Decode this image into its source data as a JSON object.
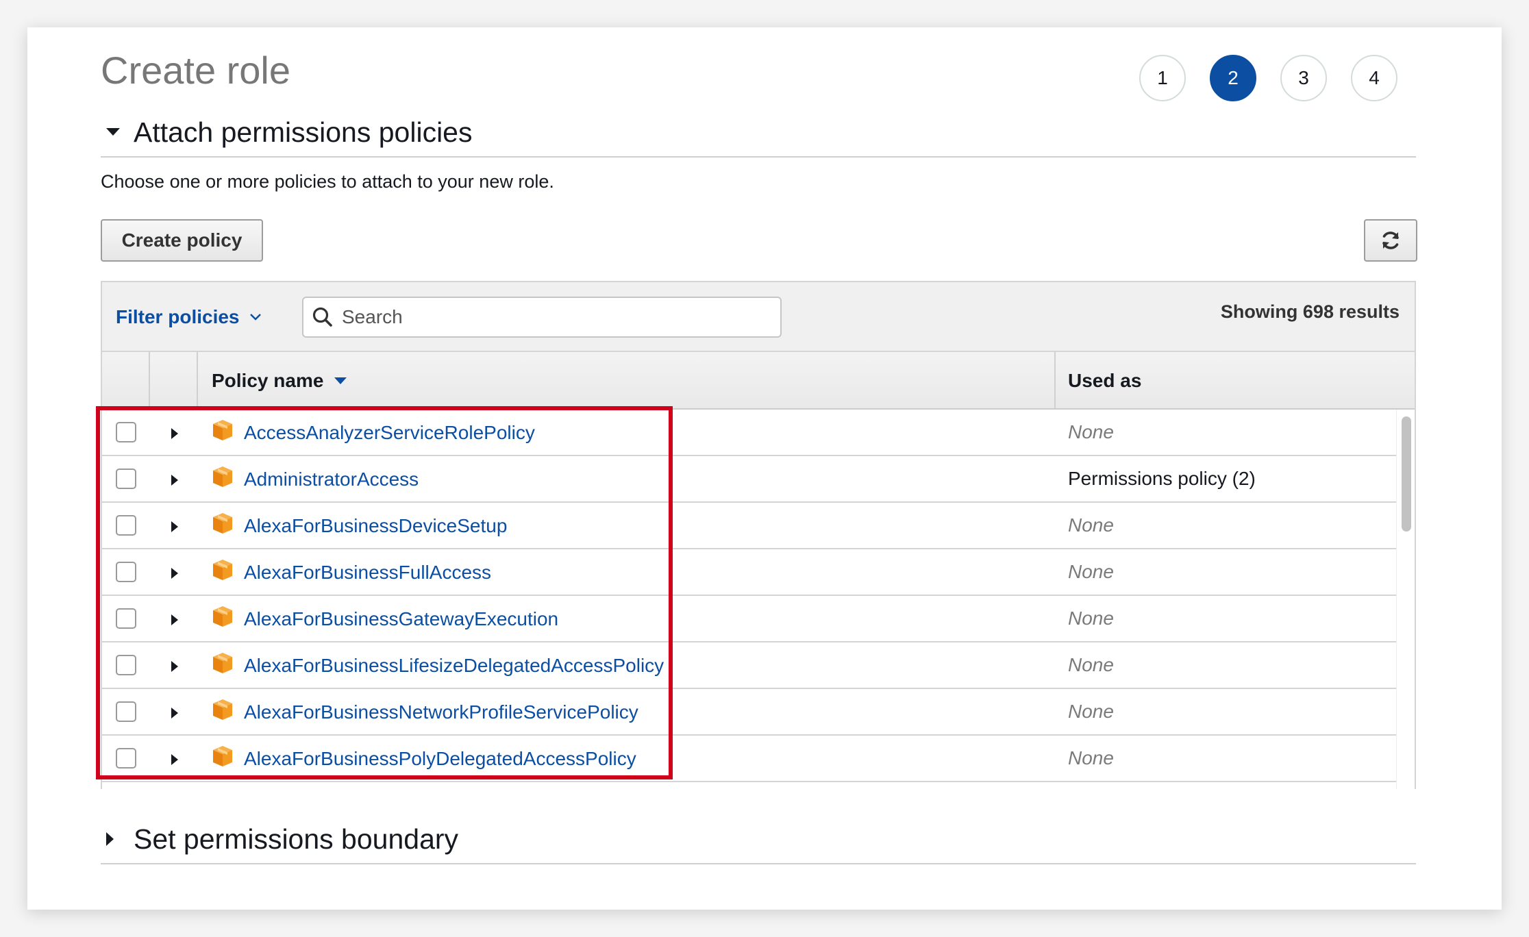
{
  "page": {
    "title": "Create role",
    "steps": [
      "1",
      "2",
      "3",
      "4"
    ],
    "active_step": "2"
  },
  "section_attach": {
    "title": "Attach permissions policies",
    "description": "Choose one or more policies to attach to your new role."
  },
  "buttons": {
    "create_policy": "Create policy"
  },
  "toolbar": {
    "filter_label": "Filter policies",
    "search_placeholder": "Search",
    "results": "Showing 698 results"
  },
  "table": {
    "columns": [
      "Policy name",
      "Used as"
    ],
    "rows": [
      {
        "name": "AccessAnalyzerServiceRolePolicy",
        "used_as": "None"
      },
      {
        "name": "AdministratorAccess",
        "used_as": "Permissions policy (2)"
      },
      {
        "name": "AlexaForBusinessDeviceSetup",
        "used_as": "None"
      },
      {
        "name": "AlexaForBusinessFullAccess",
        "used_as": "None"
      },
      {
        "name": "AlexaForBusinessGatewayExecution",
        "used_as": "None"
      },
      {
        "name": "AlexaForBusinessLifesizeDelegatedAccessPolicy",
        "used_as": "None"
      },
      {
        "name": "AlexaForBusinessNetworkProfileServicePolicy",
        "used_as": "None"
      },
      {
        "name": "AlexaForBusinessPolyDelegatedAccessPolicy",
        "used_as": "None"
      }
    ]
  },
  "section_boundary": {
    "title": "Set permissions boundary"
  },
  "colors": {
    "link": "#0b4ea2",
    "active_step": "#0b4ea2",
    "policy_icon": "#f0931b",
    "highlight": "#d0021b"
  },
  "icons": {
    "refresh": "refresh-icon",
    "search": "search-icon",
    "policy": "policy-cube-icon"
  }
}
